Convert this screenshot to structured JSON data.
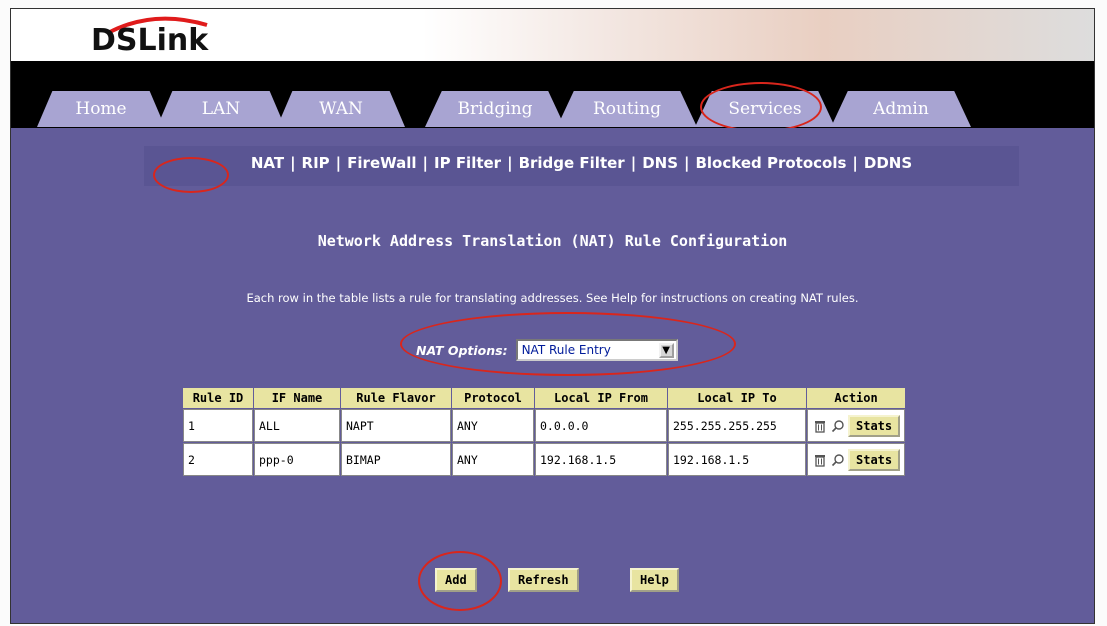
{
  "brand": {
    "logo_text": "DSLink"
  },
  "tabs": [
    {
      "label": "Home"
    },
    {
      "label": "LAN"
    },
    {
      "label": "WAN"
    },
    {
      "label": "Bridging"
    },
    {
      "label": "Routing"
    },
    {
      "label": "Services"
    },
    {
      "label": "Admin"
    }
  ],
  "active_tab": "Services",
  "subnav": {
    "items": [
      {
        "label": "NAT"
      },
      {
        "label": "RIP"
      },
      {
        "label": "FireWall"
      },
      {
        "label": "IP Filter"
      },
      {
        "label": "Bridge Filter"
      },
      {
        "label": "DNS"
      },
      {
        "label": "Blocked Protocols"
      },
      {
        "label": "DDNS"
      }
    ],
    "separator": "|"
  },
  "page": {
    "title": "Network Address Translation (NAT) Rule Configuration",
    "description": "Each row in the table lists a rule for translating addresses. See Help for instructions on creating NAT rules."
  },
  "nat_options": {
    "label": "NAT Options:",
    "selected": "NAT Rule Entry",
    "arrow": "▼"
  },
  "table": {
    "headers": [
      "Rule ID",
      "IF Name",
      "Rule Flavor",
      "Protocol",
      "Local IP From",
      "Local IP To",
      "Action"
    ],
    "rows": [
      {
        "rule_id": "1",
        "if_name": "ALL",
        "rule_flavor": "NAPT",
        "protocol": "ANY",
        "local_ip_from": "0.0.0.0",
        "local_ip_to": "255.255.255.255",
        "stats_label": "Stats"
      },
      {
        "rule_id": "2",
        "if_name": "ppp-0",
        "rule_flavor": "BIMAP",
        "protocol": "ANY",
        "local_ip_from": "192.168.1.5",
        "local_ip_to": "192.168.1.5",
        "stats_label": "Stats"
      }
    ]
  },
  "buttons": {
    "add": "Add",
    "refresh": "Refresh",
    "help": "Help"
  },
  "colors": {
    "content_bg": "#625c9a",
    "tab_bg": "#a8a4d2",
    "header_cell_bg": "#e8e4a1",
    "annotation": "#d9261c"
  },
  "icons": {
    "delete": "trash-icon",
    "view": "magnifier-icon"
  }
}
